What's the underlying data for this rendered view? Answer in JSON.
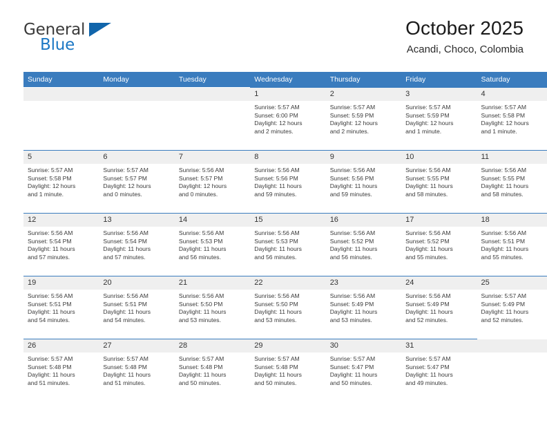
{
  "brand": {
    "name_part1": "General",
    "name_part2": "Blue",
    "triangle_color": "#1165ab",
    "blue_color": "#1b77c4"
  },
  "header": {
    "title": "October 2025",
    "subtitle": "Acandi, Choco, Colombia"
  },
  "theme": {
    "header_row_bg": "#3a7cbe",
    "daynum_bg": "#efefef",
    "cell_border": "#3a7cbe",
    "text": "#3a3a3a"
  },
  "weekdays": [
    "Sunday",
    "Monday",
    "Tuesday",
    "Wednesday",
    "Thursday",
    "Friday",
    "Saturday"
  ],
  "labels": {
    "sunrise_prefix": "Sunrise: ",
    "sunset_prefix": "Sunset: ",
    "daylight_prefix": "Daylight: "
  },
  "weeks": [
    [
      {
        "day": "",
        "empty": true
      },
      {
        "day": "",
        "empty": true
      },
      {
        "day": "",
        "empty": true
      },
      {
        "day": "1",
        "sunrise": "Sunrise: 5:57 AM",
        "sunset": "Sunset: 6:00 PM",
        "daylight_line1": "Daylight: 12 hours",
        "daylight_line2": "and 2 minutes."
      },
      {
        "day": "2",
        "sunrise": "Sunrise: 5:57 AM",
        "sunset": "Sunset: 5:59 PM",
        "daylight_line1": "Daylight: 12 hours",
        "daylight_line2": "and 2 minutes."
      },
      {
        "day": "3",
        "sunrise": "Sunrise: 5:57 AM",
        "sunset": "Sunset: 5:59 PM",
        "daylight_line1": "Daylight: 12 hours",
        "daylight_line2": "and 1 minute."
      },
      {
        "day": "4",
        "sunrise": "Sunrise: 5:57 AM",
        "sunset": "Sunset: 5:58 PM",
        "daylight_line1": "Daylight: 12 hours",
        "daylight_line2": "and 1 minute."
      }
    ],
    [
      {
        "day": "5",
        "sunrise": "Sunrise: 5:57 AM",
        "sunset": "Sunset: 5:58 PM",
        "daylight_line1": "Daylight: 12 hours",
        "daylight_line2": "and 1 minute."
      },
      {
        "day": "6",
        "sunrise": "Sunrise: 5:57 AM",
        "sunset": "Sunset: 5:57 PM",
        "daylight_line1": "Daylight: 12 hours",
        "daylight_line2": "and 0 minutes."
      },
      {
        "day": "7",
        "sunrise": "Sunrise: 5:56 AM",
        "sunset": "Sunset: 5:57 PM",
        "daylight_line1": "Daylight: 12 hours",
        "daylight_line2": "and 0 minutes."
      },
      {
        "day": "8",
        "sunrise": "Sunrise: 5:56 AM",
        "sunset": "Sunset: 5:56 PM",
        "daylight_line1": "Daylight: 11 hours",
        "daylight_line2": "and 59 minutes."
      },
      {
        "day": "9",
        "sunrise": "Sunrise: 5:56 AM",
        "sunset": "Sunset: 5:56 PM",
        "daylight_line1": "Daylight: 11 hours",
        "daylight_line2": "and 59 minutes."
      },
      {
        "day": "10",
        "sunrise": "Sunrise: 5:56 AM",
        "sunset": "Sunset: 5:55 PM",
        "daylight_line1": "Daylight: 11 hours",
        "daylight_line2": "and 58 minutes."
      },
      {
        "day": "11",
        "sunrise": "Sunrise: 5:56 AM",
        "sunset": "Sunset: 5:55 PM",
        "daylight_line1": "Daylight: 11 hours",
        "daylight_line2": "and 58 minutes."
      }
    ],
    [
      {
        "day": "12",
        "sunrise": "Sunrise: 5:56 AM",
        "sunset": "Sunset: 5:54 PM",
        "daylight_line1": "Daylight: 11 hours",
        "daylight_line2": "and 57 minutes."
      },
      {
        "day": "13",
        "sunrise": "Sunrise: 5:56 AM",
        "sunset": "Sunset: 5:54 PM",
        "daylight_line1": "Daylight: 11 hours",
        "daylight_line2": "and 57 minutes."
      },
      {
        "day": "14",
        "sunrise": "Sunrise: 5:56 AM",
        "sunset": "Sunset: 5:53 PM",
        "daylight_line1": "Daylight: 11 hours",
        "daylight_line2": "and 56 minutes."
      },
      {
        "day": "15",
        "sunrise": "Sunrise: 5:56 AM",
        "sunset": "Sunset: 5:53 PM",
        "daylight_line1": "Daylight: 11 hours",
        "daylight_line2": "and 56 minutes."
      },
      {
        "day": "16",
        "sunrise": "Sunrise: 5:56 AM",
        "sunset": "Sunset: 5:52 PM",
        "daylight_line1": "Daylight: 11 hours",
        "daylight_line2": "and 56 minutes."
      },
      {
        "day": "17",
        "sunrise": "Sunrise: 5:56 AM",
        "sunset": "Sunset: 5:52 PM",
        "daylight_line1": "Daylight: 11 hours",
        "daylight_line2": "and 55 minutes."
      },
      {
        "day": "18",
        "sunrise": "Sunrise: 5:56 AM",
        "sunset": "Sunset: 5:51 PM",
        "daylight_line1": "Daylight: 11 hours",
        "daylight_line2": "and 55 minutes."
      }
    ],
    [
      {
        "day": "19",
        "sunrise": "Sunrise: 5:56 AM",
        "sunset": "Sunset: 5:51 PM",
        "daylight_line1": "Daylight: 11 hours",
        "daylight_line2": "and 54 minutes."
      },
      {
        "day": "20",
        "sunrise": "Sunrise: 5:56 AM",
        "sunset": "Sunset: 5:51 PM",
        "daylight_line1": "Daylight: 11 hours",
        "daylight_line2": "and 54 minutes."
      },
      {
        "day": "21",
        "sunrise": "Sunrise: 5:56 AM",
        "sunset": "Sunset: 5:50 PM",
        "daylight_line1": "Daylight: 11 hours",
        "daylight_line2": "and 53 minutes."
      },
      {
        "day": "22",
        "sunrise": "Sunrise: 5:56 AM",
        "sunset": "Sunset: 5:50 PM",
        "daylight_line1": "Daylight: 11 hours",
        "daylight_line2": "and 53 minutes."
      },
      {
        "day": "23",
        "sunrise": "Sunrise: 5:56 AM",
        "sunset": "Sunset: 5:49 PM",
        "daylight_line1": "Daylight: 11 hours",
        "daylight_line2": "and 53 minutes."
      },
      {
        "day": "24",
        "sunrise": "Sunrise: 5:56 AM",
        "sunset": "Sunset: 5:49 PM",
        "daylight_line1": "Daylight: 11 hours",
        "daylight_line2": "and 52 minutes."
      },
      {
        "day": "25",
        "sunrise": "Sunrise: 5:57 AM",
        "sunset": "Sunset: 5:49 PM",
        "daylight_line1": "Daylight: 11 hours",
        "daylight_line2": "and 52 minutes."
      }
    ],
    [
      {
        "day": "26",
        "sunrise": "Sunrise: 5:57 AM",
        "sunset": "Sunset: 5:48 PM",
        "daylight_line1": "Daylight: 11 hours",
        "daylight_line2": "and 51 minutes."
      },
      {
        "day": "27",
        "sunrise": "Sunrise: 5:57 AM",
        "sunset": "Sunset: 5:48 PM",
        "daylight_line1": "Daylight: 11 hours",
        "daylight_line2": "and 51 minutes."
      },
      {
        "day": "28",
        "sunrise": "Sunrise: 5:57 AM",
        "sunset": "Sunset: 5:48 PM",
        "daylight_line1": "Daylight: 11 hours",
        "daylight_line2": "and 50 minutes."
      },
      {
        "day": "29",
        "sunrise": "Sunrise: 5:57 AM",
        "sunset": "Sunset: 5:48 PM",
        "daylight_line1": "Daylight: 11 hours",
        "daylight_line2": "and 50 minutes."
      },
      {
        "day": "30",
        "sunrise": "Sunrise: 5:57 AM",
        "sunset": "Sunset: 5:47 PM",
        "daylight_line1": "Daylight: 11 hours",
        "daylight_line2": "and 50 minutes."
      },
      {
        "day": "31",
        "sunrise": "Sunrise: 5:57 AM",
        "sunset": "Sunset: 5:47 PM",
        "daylight_line1": "Daylight: 11 hours",
        "daylight_line2": "and 49 minutes."
      },
      {
        "day": "",
        "empty": true
      }
    ]
  ]
}
